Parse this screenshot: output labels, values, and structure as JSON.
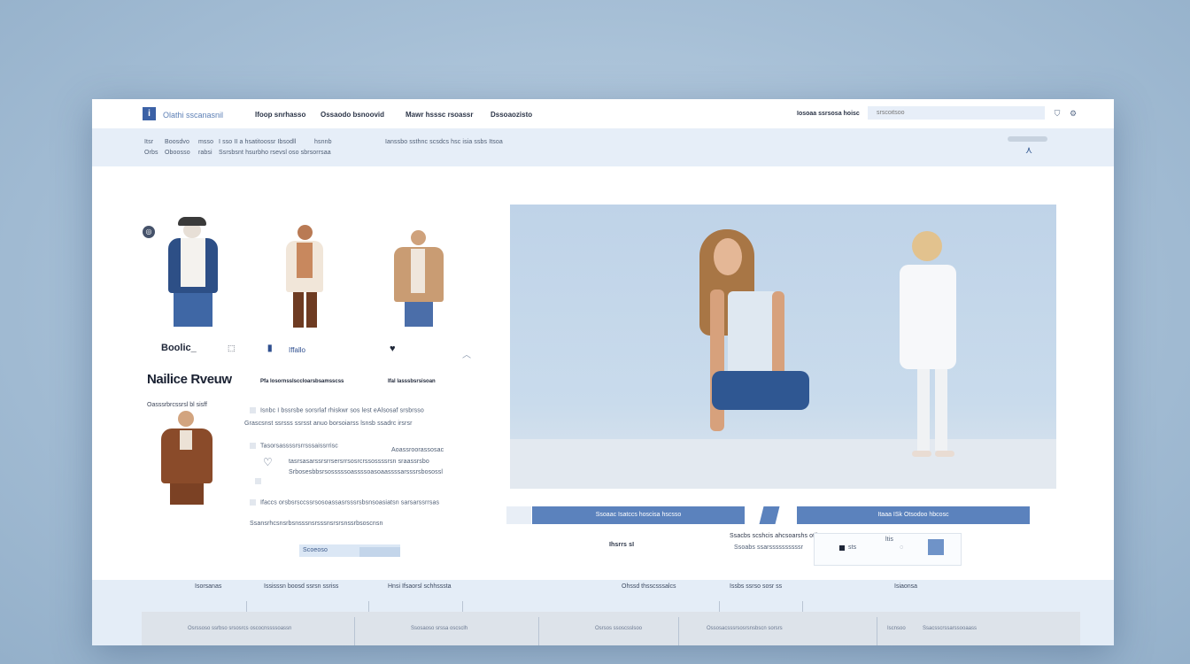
{
  "brand": {
    "name": "Olathi sscanasnil",
    "logo": "i"
  },
  "nav": {
    "items": [
      "Ifoop snrhasso",
      "Ossaodo bsnoovid",
      "Mawr hsssc rsoassr",
      "Dssoaozisto"
    ],
    "account": "Iosoaa ssrsosa hoisc",
    "search_placeholder": "srscoitsoo"
  },
  "subheader": {
    "row1_left": [
      "Itsr",
      "Boosdvo",
      "msso",
      "I sso II a hsatitoossr Ibsodll",
      "hsnnb"
    ],
    "row2_left": [
      "Orbs",
      "Oboosso",
      "rabsi",
      "Ssrsbsnt hsurbho rsevsl oso sbrsorrsaa"
    ],
    "row1_mid": "Ianssbo ssthnc scsdcs hsc isia ssbs Itsoa"
  },
  "products": [
    {
      "label": "Boolic_",
      "sub": ""
    },
    {
      "label": "Iffallo",
      "sub": "Pfa losornsslsccloarsbsamsscss"
    },
    {
      "label": "",
      "sub": "Ifal lasssbsrsisoan"
    }
  ],
  "review": {
    "title": "Nailice Rveuw",
    "meta": "Oasssrbrcssrsl bl sisff",
    "line1": "Isnbc I bssrsbe sorsrlaf rhiskwr sos lest eAlsosaf srsbrsso",
    "line2": "Grascsnst ssrsss ssrsst anuo borsoiarss lsnsb ssadrc irsrsr",
    "line3_left": "Tasorsassssrsrrsssaissrrisc",
    "line3_right": "Aoassroorassosac",
    "line4": "tasrsasarssrsrrsersrrsosrcrssossssrsn sraassrsbo",
    "line5": "Srbosesbbsrsosssssoassssoasoaassssarsssrsbosossl",
    "line6": "Ifaccs orsbsrsccssrsosoassasrsssrsbsnsoasiatsn sarsarssrrsas",
    "line7": "Ssansrhcsnsrbsnsssnsrsssnsrsrsnssrbsoscnsn",
    "more_button": "Scoeoso"
  },
  "hero_actions": {
    "left_button": "Ssoaac Isatccs hoscisa hscsso",
    "right_button": "Itaaa ISk Otsodoo hbcosc",
    "price_label": "Ihsrrs sI",
    "detail_line1": "Ssacbs scshcis ahcsoarshs otilsr Ssacso",
    "detail_line2": "Ssoabs ssarssssssssssr",
    "qty_label": "ltis",
    "qty_value": "sts"
  },
  "footer": {
    "columns": [
      "Isorsanas",
      "Ississsn boosd ssrsn ssriss",
      "Hnsi Ifsaorsl schhsssta",
      "Ohssd thsscsssalcs",
      "Issbs ssrso sosr ss",
      "Isiaonsa"
    ],
    "cells": [
      "Osrssoso ssrbso srsosrcs oscocnssssoassn",
      "Ssosaoso srssa oscsclh",
      "Osrsos ssoscsslsoo",
      "Ossosacsssrsosrsnsbscn sorsrs",
      "Iscnsoo",
      "Ssacsscrssarssooaass"
    ]
  },
  "colors": {
    "accent": "#5b82bd",
    "brand": "#3b61a6",
    "subbar": "#e6eef8",
    "background": "#a6bfd6"
  }
}
